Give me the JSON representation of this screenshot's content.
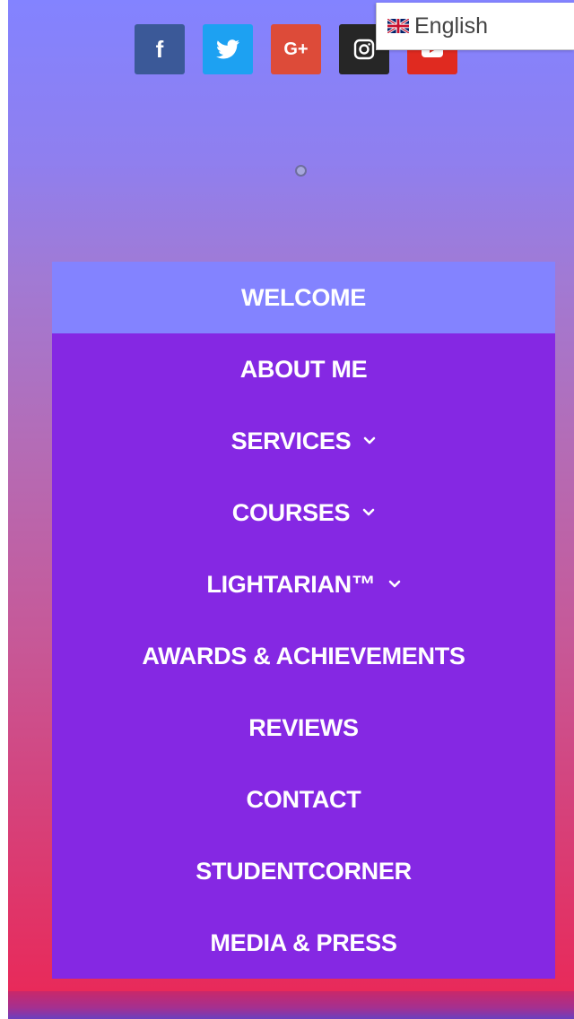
{
  "socials": [
    {
      "name": "facebook",
      "glyph": "f",
      "color": "#3b5998"
    },
    {
      "name": "twitter",
      "glyph": "",
      "color": "#1da1f2"
    },
    {
      "name": "google-plus",
      "glyph": "G+",
      "color": "#dd4b39"
    },
    {
      "name": "instagram",
      "glyph": "",
      "color": "#262626"
    },
    {
      "name": "youtube",
      "glyph": "",
      "color": "#e02a20"
    }
  ],
  "language": {
    "label": "English",
    "flag_icon": "uk-flag-icon"
  },
  "menu": {
    "items": [
      {
        "label": "WELCOME",
        "active": true,
        "has_dropdown": false
      },
      {
        "label": "ABOUT ME",
        "active": false,
        "has_dropdown": false
      },
      {
        "label": "SERVICES",
        "active": false,
        "has_dropdown": true
      },
      {
        "label": "COURSES",
        "active": false,
        "has_dropdown": true
      },
      {
        "label": "LIGHTARIAN™",
        "active": false,
        "has_dropdown": true
      },
      {
        "label": "AWARDS & ACHIEVEMENTS",
        "active": false,
        "has_dropdown": false
      },
      {
        "label": "REVIEWS",
        "active": false,
        "has_dropdown": false
      },
      {
        "label": "CONTACT",
        "active": false,
        "has_dropdown": false
      },
      {
        "label": "STUDENTCORNER",
        "active": false,
        "has_dropdown": false
      },
      {
        "label": "MEDIA & PRESS",
        "active": false,
        "has_dropdown": false
      }
    ]
  },
  "colors": {
    "menu_bg": "#8528e3",
    "menu_active_bg": "#8383ff",
    "gradient_top": "#8383ff",
    "gradient_bottom": "#e82a5a"
  }
}
